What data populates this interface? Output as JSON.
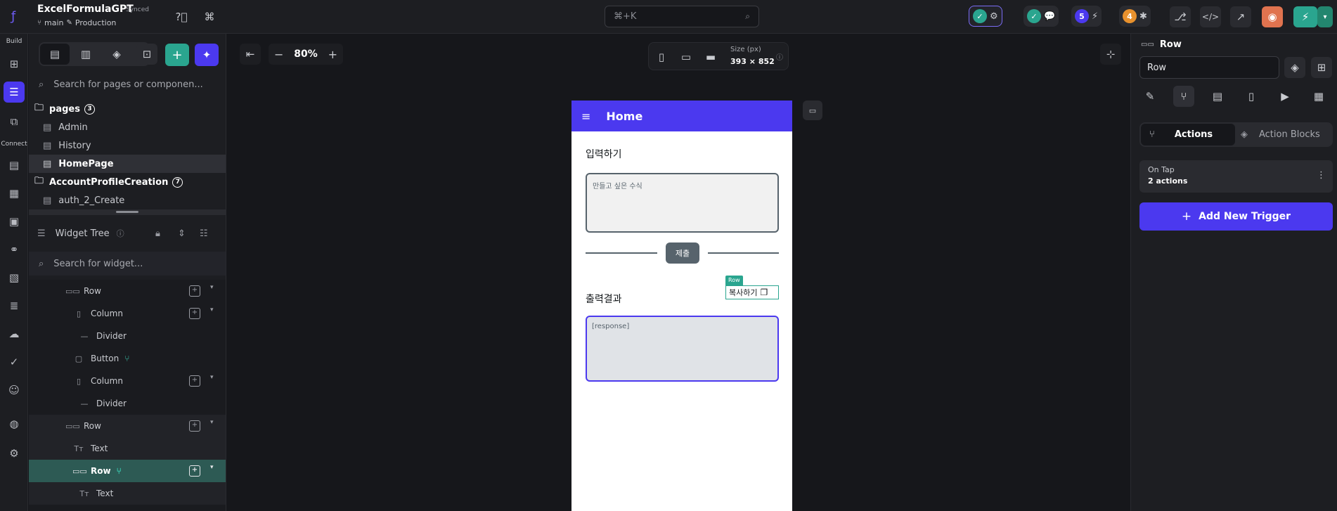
{
  "colors": {
    "accent": "#4b39ef",
    "teal": "#2aa58f",
    "canvas_page": "#ffffff"
  },
  "topbar": {
    "project_name": "ExcelFormulaGPT",
    "sync_status": "Synced",
    "branch": "main",
    "environment": "Production",
    "search_placeholder": "⌘+K",
    "badge_5": "5",
    "badge_4": "4"
  },
  "rail": {
    "build_label": "Build",
    "connect_label": "Connect"
  },
  "left": {
    "page_search_placeholder": "Search for pages or componen...",
    "pages_label": "pages",
    "pages_count": "3",
    "pages": [
      "Admin",
      "History",
      "HomePage"
    ],
    "folder2_label": "AccountProfileCreation",
    "folder2_count": "7",
    "folder2_items": [
      "auth_2_Create"
    ],
    "widget_tree_label": "Widget Tree",
    "widget_search_placeholder": "Search for widget...",
    "tree": [
      "Row",
      "Column",
      "Divider",
      "Button",
      "Column",
      "Divider",
      "Row",
      "Text",
      "Row",
      "Text"
    ]
  },
  "canvas": {
    "zoom": "80%",
    "size_label": "Size (px)",
    "size_value": "393 × 852",
    "appbar_title": "Home",
    "input_heading": "입력하기",
    "input_placeholder": "만들고 싶은 수식",
    "submit_label": "제출",
    "output_heading": "출력결과",
    "row_tag": "Row",
    "copy_label": "복사하기",
    "response_text": "[response]"
  },
  "right": {
    "header_label": "Row",
    "name_value": "Row",
    "tab_actions": "Actions",
    "tab_blocks": "Action Blocks",
    "trigger_name": "On Tap",
    "trigger_count": "2 actions",
    "add_trigger_label": "Add New Trigger"
  }
}
